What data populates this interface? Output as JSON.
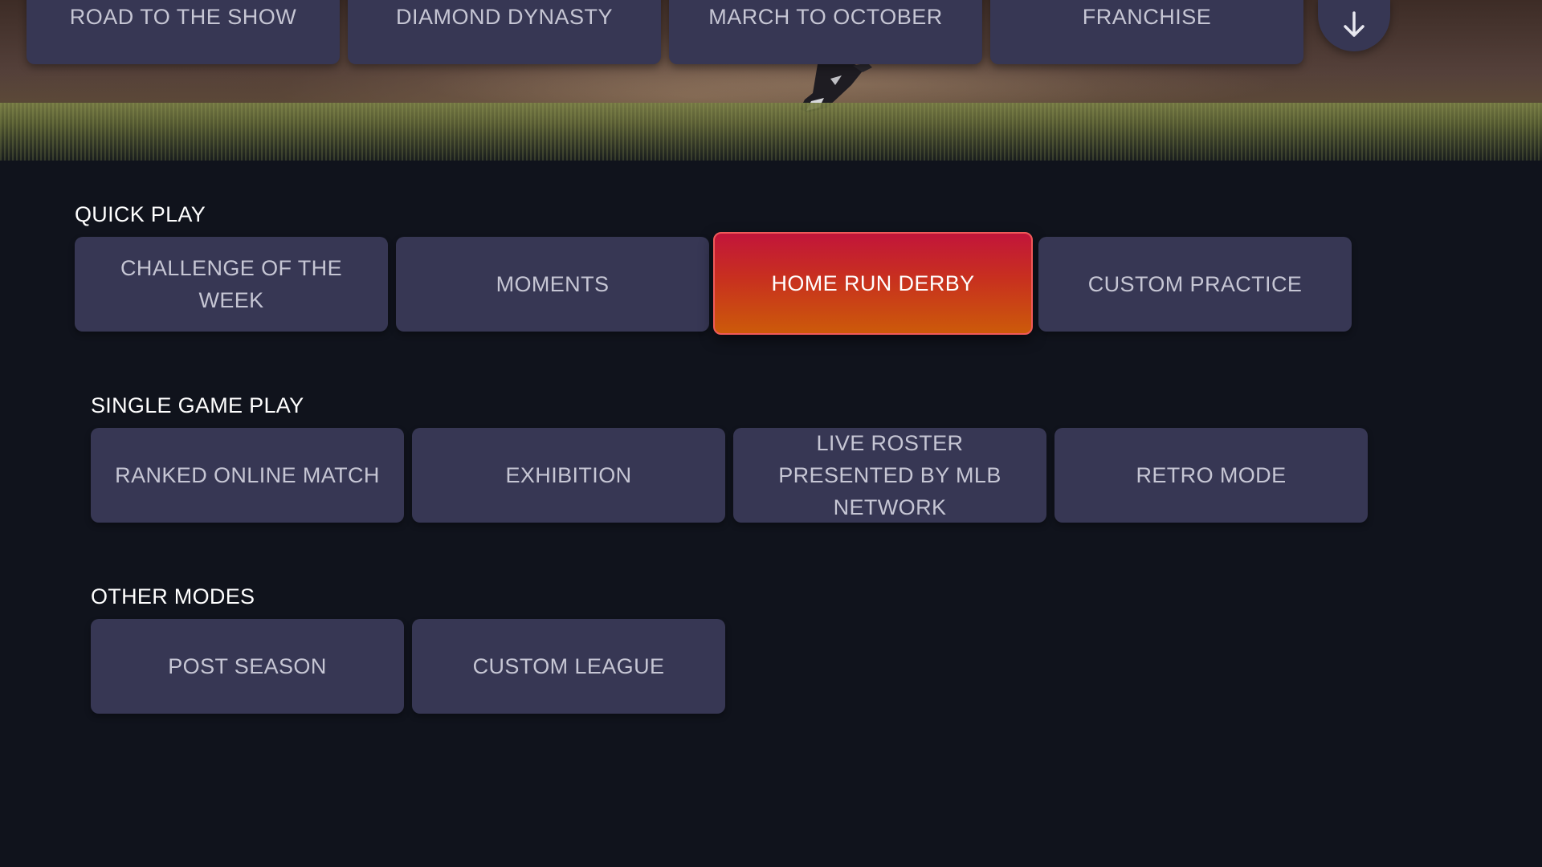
{
  "top_nav": {
    "tabs": [
      {
        "label": "ROAD TO THE SHOW"
      },
      {
        "label": "DIAMOND DYNASTY"
      },
      {
        "label": "MARCH TO OCTOBER"
      },
      {
        "label": "FRANCHISE"
      }
    ],
    "more_button_icon": "arrow-down-icon"
  },
  "sections": [
    {
      "title": "QUICK PLAY",
      "items": [
        {
          "label": "CHALLENGE OF THE WEEK"
        },
        {
          "label": "MOMENTS"
        },
        {
          "label": "HOME RUN DERBY"
        },
        {
          "label": "CUSTOM PRACTICE"
        }
      ]
    },
    {
      "title": "SINGLE GAME PLAY",
      "items": [
        {
          "label": "RANKED ONLINE MATCH"
        },
        {
          "label": "EXHIBITION"
        },
        {
          "label": "LIVE ROSTER PRESENTED BY MLB NETWORK"
        },
        {
          "label": "RETRO MODE"
        }
      ]
    },
    {
      "title": "OTHER MODES",
      "items": [
        {
          "label": "POST SEASON"
        },
        {
          "label": "CUSTOM LEAGUE"
        }
      ]
    }
  ],
  "selected_item": "HOME RUN DERBY",
  "colors": {
    "background": "#10131c",
    "tile": "#373754",
    "tile_text": "#c6c6d4",
    "selected_top": "#c2153a",
    "selected_bottom": "#cc5a0a",
    "heading_text": "#ffffff"
  }
}
